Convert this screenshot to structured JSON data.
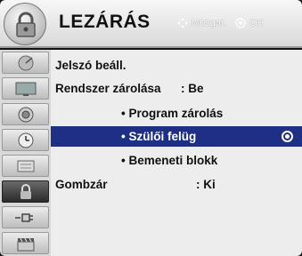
{
  "header": {
    "title": "LEZÁRÁS",
    "hint_move": "Mozgat.",
    "hint_ok": "OK",
    "icon": "lock-icon"
  },
  "sidebar": {
    "items": [
      {
        "icon": "satellite-dish-icon"
      },
      {
        "icon": "tv-screen-icon"
      },
      {
        "icon": "speaker-icon"
      },
      {
        "icon": "clock-icon"
      },
      {
        "icon": "settings-panel-icon"
      },
      {
        "icon": "lock-icon",
        "active": true
      },
      {
        "icon": "plug-icon"
      },
      {
        "icon": "clapperboard-icon"
      }
    ]
  },
  "menu": {
    "password_label": "Jelszó beáll.",
    "system_lock_label": "Rendszer zárolása",
    "system_lock_value": ": Be",
    "program_lock_label": "• Program zárolás",
    "parental_label": "• Szülői felüg",
    "input_block_label": "• Bemeneti blokk",
    "key_lock_label": "Gombzár",
    "key_lock_value": ": Ki"
  },
  "colors": {
    "selection": "#1f2f86",
    "header_bg": "#e6e6e6",
    "content_bg": "#ededed"
  }
}
